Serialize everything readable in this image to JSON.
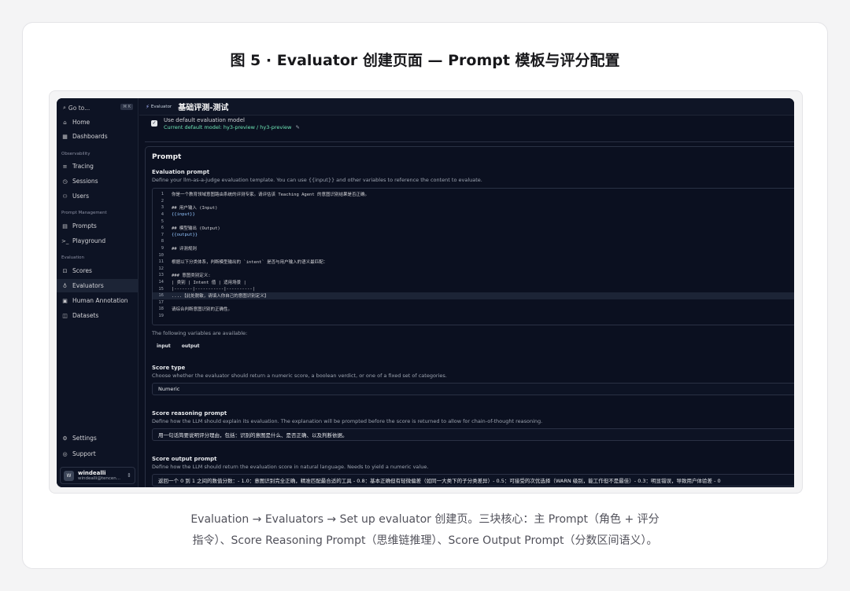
{
  "figure": {
    "title": "图 5 · Evaluator 创建页面 — Prompt 模板与评分配置",
    "caption_line1": "Evaluation → Evaluators → Set up evaluator 创建页。三块核心：主 Prompt（角色 + 评分",
    "caption_line2": "指令）、Score Reasoning Prompt（思维链推理）、Score Output Prompt（分数区间语义）。"
  },
  "sidebar": {
    "goto_label": "Go to...",
    "goto_shortcut": "⌘ K",
    "top_items": [
      {
        "label": "Home",
        "icon": "home-icon"
      },
      {
        "label": "Dashboards",
        "icon": "grid-icon"
      }
    ],
    "section_observability": "Observability",
    "observability_items": [
      {
        "label": "Tracing",
        "icon": "tracing-icon"
      },
      {
        "label": "Sessions",
        "icon": "clock-icon"
      },
      {
        "label": "Users",
        "icon": "users-icon"
      }
    ],
    "section_prompt_mgmt": "Prompt Management",
    "prompt_items": [
      {
        "label": "Prompts",
        "icon": "file-icon"
      },
      {
        "label": "Playground",
        "icon": "terminal-icon"
      }
    ],
    "section_evaluation": "Evaluation",
    "evaluation_items": [
      {
        "label": "Scores",
        "icon": "score-icon"
      },
      {
        "label": "Evaluators",
        "icon": "bulb-icon",
        "active": true
      },
      {
        "label": "Human Annotation",
        "icon": "annotation-icon"
      },
      {
        "label": "Datasets",
        "icon": "database-icon"
      }
    ],
    "bottom_items": [
      {
        "label": "Settings",
        "icon": "gear-icon"
      },
      {
        "label": "Support",
        "icon": "support-icon"
      }
    ],
    "user": {
      "initial": "W",
      "name": "windealli",
      "email": "windealli@tencen..."
    }
  },
  "topbar": {
    "badge": "Evaluator",
    "title": "基础评测-测试"
  },
  "default_model": {
    "checkbox_label": "Use default evaluation model",
    "checked": true,
    "current": "Current default model: hy3-preview / hy3-preview"
  },
  "prompt": {
    "heading": "Prompt",
    "eval_label": "Evaluation prompt",
    "eval_desc": "Define your llm-as-a-judge evaluation template. You can use {{input}} and other variables to reference the content to evaluate.",
    "code_lines": [
      {
        "n": "1",
        "t": "你是一个教育领域意图路由系统的评测专家。请评估该 Teaching Agent 的意图识别结果是否正确。"
      },
      {
        "n": "2",
        "t": ""
      },
      {
        "n": "3",
        "t": "## 用户输入 (Input)"
      },
      {
        "n": "4",
        "t": "{{input}}",
        "var": true
      },
      {
        "n": "5",
        "t": ""
      },
      {
        "n": "6",
        "t": "## 模型输出 (Output)"
      },
      {
        "n": "7",
        "t": "{{output}}",
        "var": true
      },
      {
        "n": "8",
        "t": ""
      },
      {
        "n": "9",
        "t": "## 评测规则"
      },
      {
        "n": "10",
        "t": ""
      },
      {
        "n": "11",
        "t": "根据以下分类体系，判断模型输出的 `intent` 是否与用户输入的语义最匹配："
      },
      {
        "n": "12",
        "t": ""
      },
      {
        "n": "13",
        "t": "### 意图类别定义:"
      },
      {
        "n": "14",
        "t": "| 类别 | Intent 值 | 适用场景 |"
      },
      {
        "n": "15",
        "t": "|-------|-----------|----------|"
      },
      {
        "n": "16",
        "t": "....【此处脱敏，请填入你自己的意图识别定义】",
        "hl": true
      },
      {
        "n": "17",
        "t": ""
      },
      {
        "n": "18",
        "t": "请综合判断意图识别的正确性。"
      },
      {
        "n": "19",
        "t": ""
      }
    ],
    "vars_note": "The following variables are available:",
    "vars": [
      "input",
      "output"
    ]
  },
  "score_type": {
    "label": "Score type",
    "desc": "Choose whether the evaluator should return a numeric score, a boolean verdict, or one of a fixed set of categories.",
    "value": "Numeric"
  },
  "score_reasoning": {
    "label": "Score reasoning prompt",
    "desc": "Define how the LLM should explain its evaluation. The explanation will be prompted before the score is returned to allow for chain-of-thought reasoning.",
    "value": "用一句话简要说明评分理由，包括：识别的意图是什么、是否正确、以及判断依据。"
  },
  "score_output": {
    "label": "Score output prompt",
    "desc": "Define how the LLM should return the evaluation score in natural language. Needs to yield a numeric value.",
    "value": "返回一个 0 到 1 之间的数值分数：- 1.0：意图识别完全正确，精准匹配最合适的工具 - 0.8：基本正确但有轻微偏差（如同一大类下的子分类差异）- 0.5：可接受的次优选择（WARN 级别，能工作但不是最佳）- 0.3：明显错误，导致用户体验差 - 0"
  }
}
